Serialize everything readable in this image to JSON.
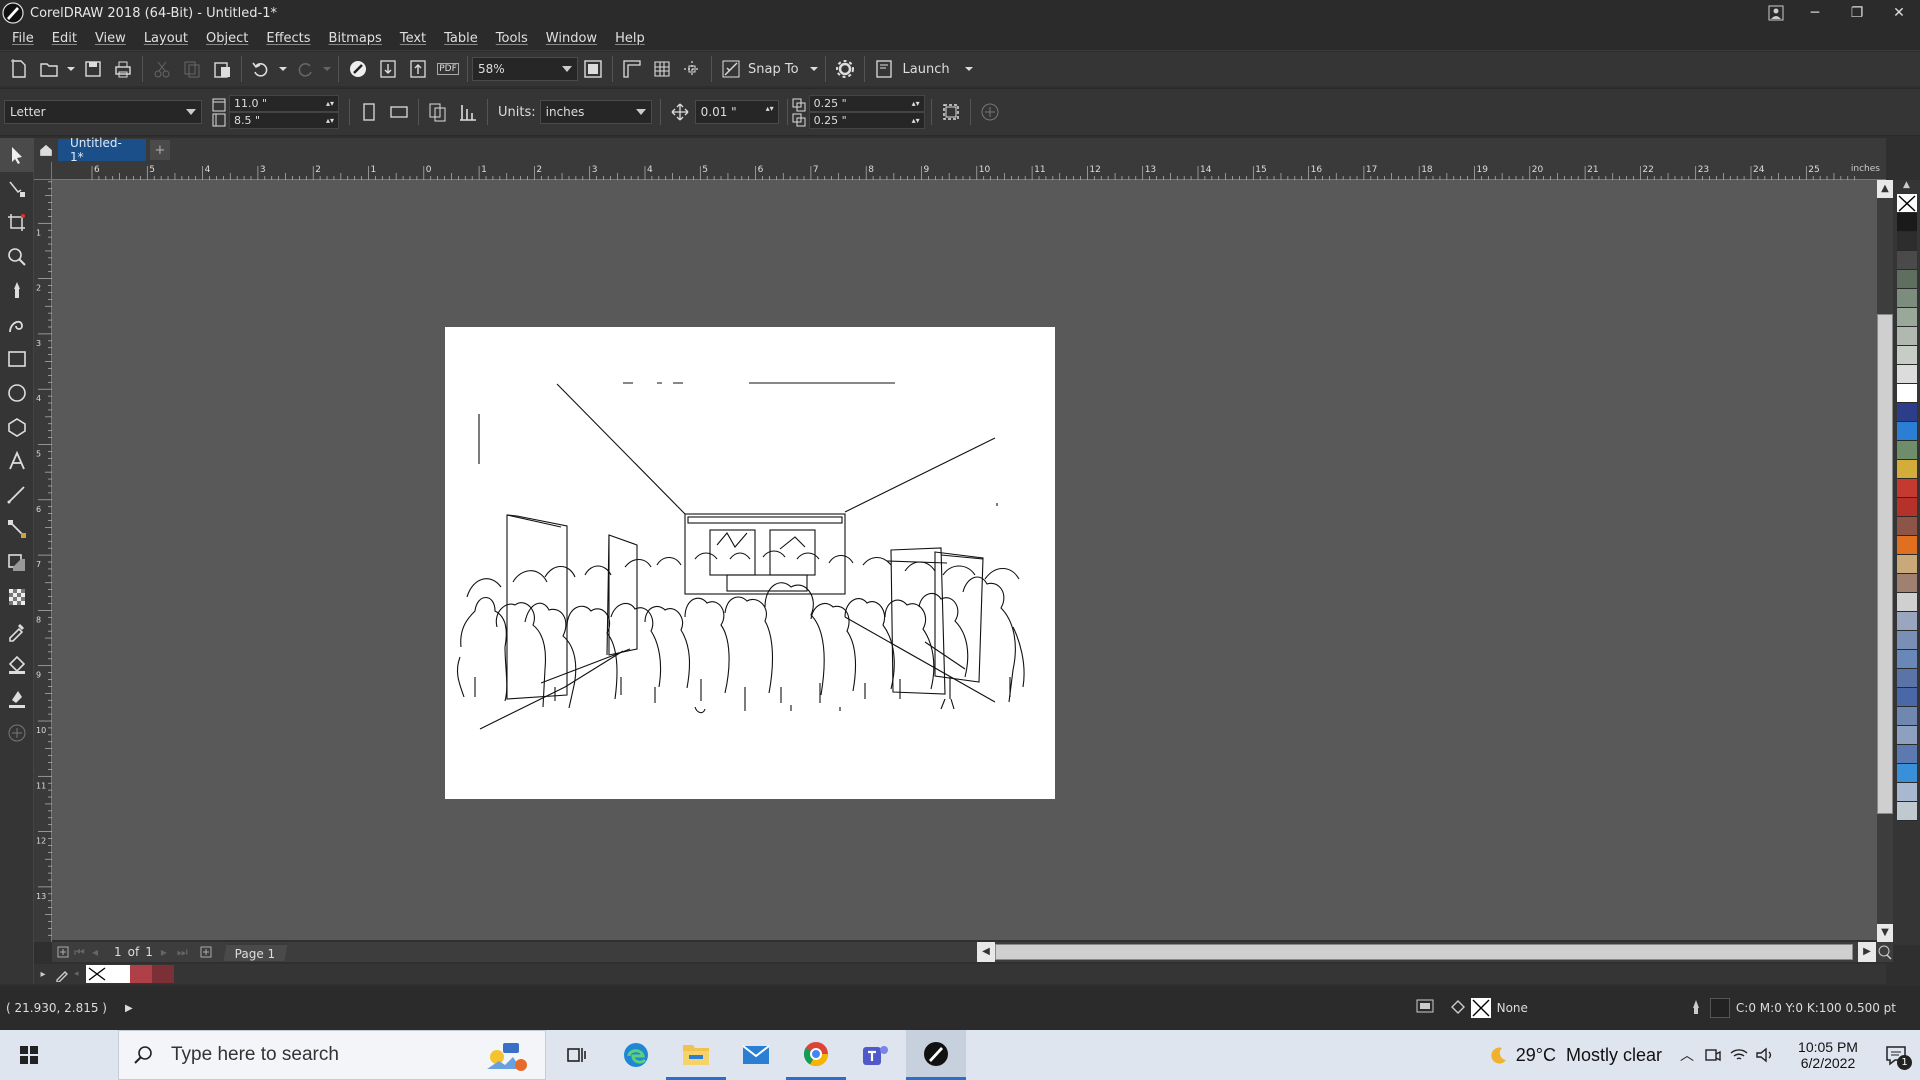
{
  "window": {
    "title": "CorelDRAW 2018 (64-Bit) - Untitled-1*",
    "controls": [
      "─",
      "❐",
      "✕"
    ]
  },
  "menu": [
    "File",
    "Edit",
    "View",
    "Layout",
    "Object",
    "Effects",
    "Bitmaps",
    "Text",
    "Table",
    "Tools",
    "Window",
    "Help"
  ],
  "standard_toolbar": {
    "zoom_value": "58%",
    "snap_label": "Snap To",
    "launch_label": "Launch",
    "pdf_label": "PDF"
  },
  "property_bar": {
    "page_size": "Letter",
    "width": "11.0 \"",
    "height": "8.5 \"",
    "units_label": "Units:",
    "units_value": "inches",
    "nudge": "0.01 \"",
    "dup_x": "0.25 \"",
    "dup_y": "0.25 \""
  },
  "doc_tab": {
    "label": "Untitled-1*",
    "add": "+"
  },
  "ruler": {
    "unit": "inches",
    "top_labels": [
      "6",
      "5",
      "4",
      "3",
      "2",
      "1",
      "0",
      "1",
      "2",
      "3",
      "4",
      "5",
      "6",
      "7",
      "8",
      "9",
      "10",
      "11",
      "12",
      "13",
      "14",
      "15",
      "16",
      "17",
      "18",
      "19",
      "20",
      "21",
      "22",
      "23",
      "24",
      "25"
    ],
    "left_labels": [
      "0",
      "1",
      "2",
      "3",
      "4",
      "5",
      "6",
      "7",
      "8",
      "9",
      "10",
      "11",
      "12",
      "13"
    ]
  },
  "page_nav": {
    "current": "1",
    "of": "of",
    "total": "1",
    "page_tab": "Page 1"
  },
  "status": {
    "coords": "( 21.930, 2.815 )",
    "fill_label": "None",
    "outline": "C:0 M:0 Y:0 K:100  0.500 pt"
  },
  "palette_colors": [
    "#1a1a1a",
    "#2d2d2d",
    "#4a4a4a",
    "#5f6f5f",
    "#7d8d7d",
    "#9aa89a",
    "#b0b8b0",
    "#c6ccc6",
    "#dcdcdc",
    "#ffffff",
    "#2c3e8a",
    "#2a7fd4",
    "#6f8d6a",
    "#d4ac3a",
    "#c43a30",
    "#b5322a",
    "#8c5548",
    "#e07020",
    "#c9a87a",
    "#a08070",
    "#d0d0d0",
    "#9aa6c0",
    "#7a8fb5",
    "#6888b8",
    "#5a74a8",
    "#4a68a8",
    "#7088b0",
    "#8ea0c0",
    "#5c7ab0",
    "#3a90d8",
    "#a8b8d0",
    "#c0c8d0"
  ],
  "taskbar": {
    "search_placeholder": "Type here to search",
    "weather_temp": "29°C",
    "weather_desc": "Mostly clear",
    "time": "10:05 PM",
    "date": "6/2/2022",
    "notification_count": "1"
  }
}
